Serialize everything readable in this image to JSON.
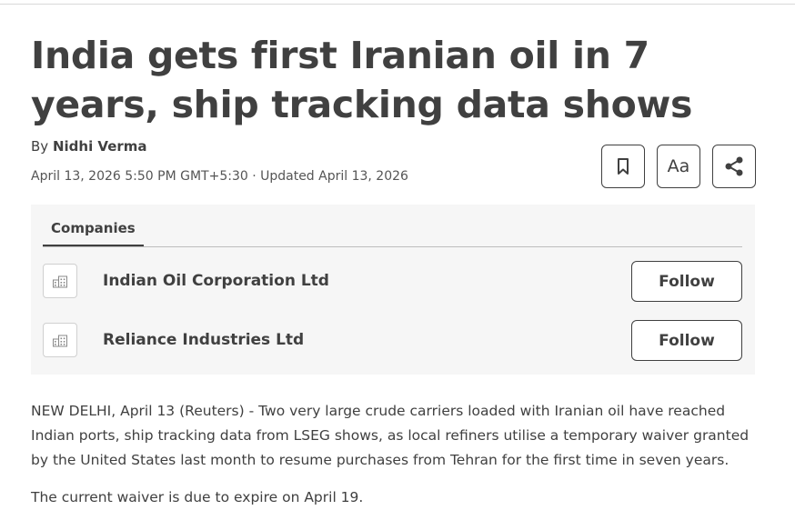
{
  "article": {
    "headline": "India gets first Iranian oil in 7 years, ship tracking data shows",
    "by_prefix": "By",
    "author": "Nidhi Verma",
    "dateline": "April 13, 2026 5:50 PM GMT+5:30 · Updated April 13, 2026"
  },
  "tools": {
    "bookmark_icon": "bookmark-icon",
    "text_size_label": "Aa",
    "share_icon": "share-icon"
  },
  "companies": {
    "tab_label": "Companies",
    "items": [
      {
        "name": "Indian Oil Corporation Ltd",
        "follow_label": "Follow",
        "icon": "building-icon"
      },
      {
        "name": "Reliance Industries Ltd",
        "follow_label": "Follow",
        "icon": "building-icon"
      }
    ]
  },
  "body": {
    "paragraphs": [
      "NEW DELHI, April 13 (Reuters) - Two very large crude carriers loaded with Iranian oil have reached Indian ports, ship tracking data from LSEG shows, as local refiners utilise a temporary waiver granted by the United States last month to resume purchases from Tehran for the first time in seven years.",
      "The current waiver is due to expire on April 19."
    ]
  }
}
